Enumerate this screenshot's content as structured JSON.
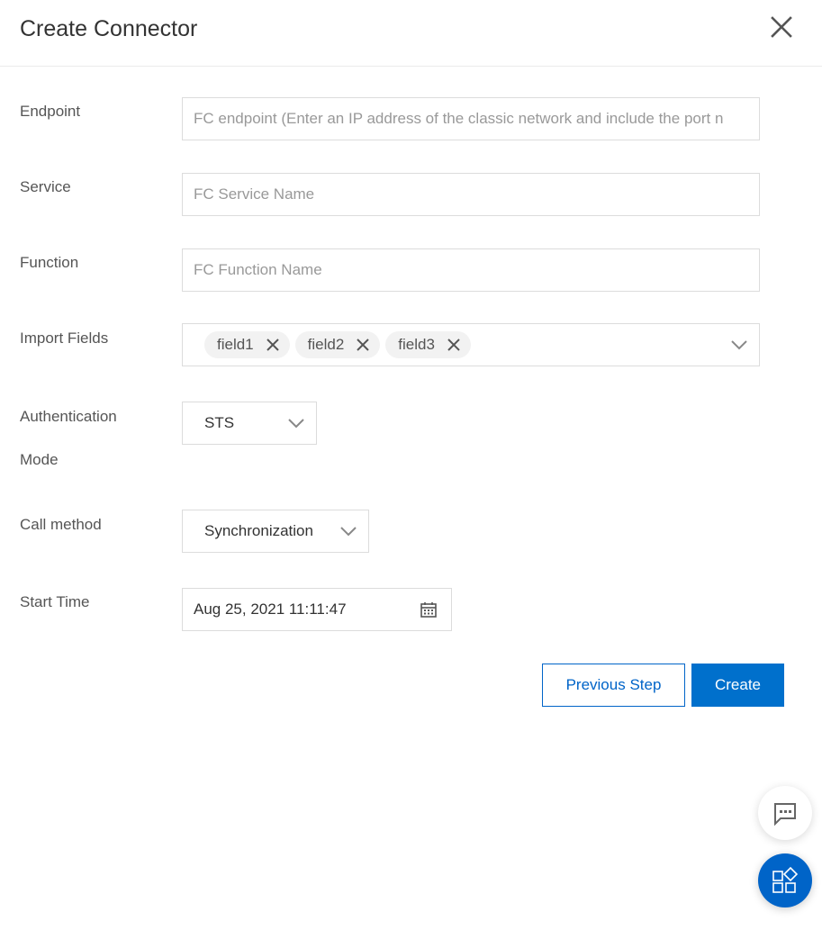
{
  "dialog": {
    "title": "Create Connector",
    "close_icon": "close-icon"
  },
  "form": {
    "endpoint": {
      "label": "Endpoint",
      "value": "",
      "placeholder": "FC endpoint (Enter an IP address of the classic network and include the port n"
    },
    "service": {
      "label": "Service",
      "value": "",
      "placeholder": "FC Service Name"
    },
    "function": {
      "label": "Function",
      "value": "",
      "placeholder": "FC Function Name"
    },
    "import_fields": {
      "label": "Import Fields",
      "tags": [
        "field1",
        "field2",
        "field3"
      ]
    },
    "auth_mode": {
      "label_line1": "Authentication",
      "label_line2": "Mode",
      "value": "STS"
    },
    "call_method": {
      "label": "Call method",
      "value": "Synchronization"
    },
    "start_time": {
      "label": "Start Time",
      "value": "Aug 25, 2021 11:11:47"
    }
  },
  "actions": {
    "previous_label": "Previous Step",
    "create_label": "Create"
  },
  "floating": {
    "chat_icon": "chat-icon",
    "apps_icon": "apps-icon"
  },
  "colors": {
    "primary": "#0070cc",
    "primary_border": "#0064c8",
    "border": "#dcdcdc",
    "tag_bg": "#f2f2f2"
  }
}
